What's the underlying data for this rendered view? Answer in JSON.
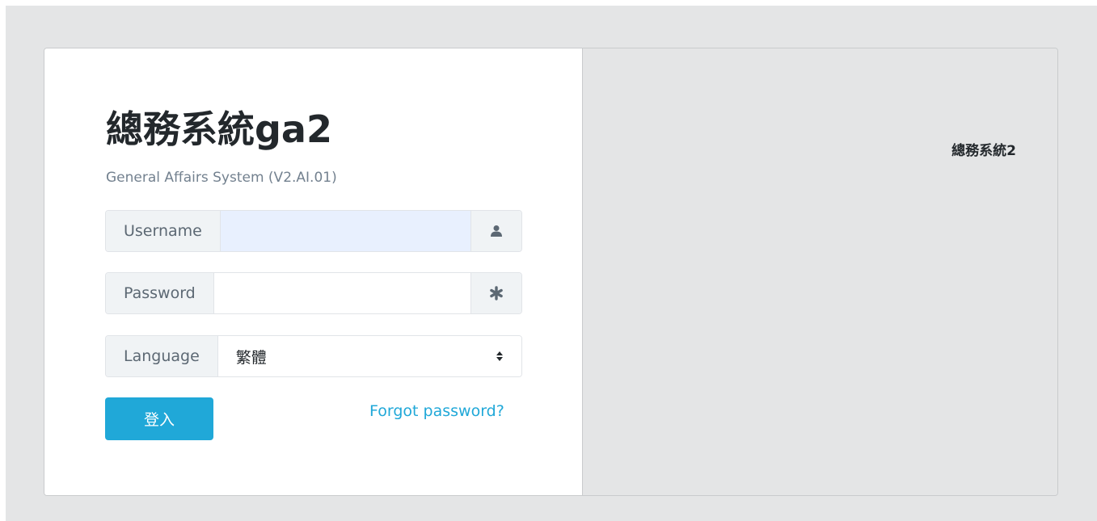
{
  "login": {
    "title": "總務系統ga2",
    "subtitle": "General Affairs System (V2.AI.01)",
    "username": {
      "label": "Username",
      "value": "",
      "icon": "user-icon"
    },
    "password": {
      "label": "Password",
      "value": "",
      "icon": "asterisk-icon"
    },
    "language": {
      "label": "Language",
      "selected": "繁體",
      "icon": "sort-arrows-icon"
    },
    "submit_label": "登入",
    "forgot_label": "Forgot password?"
  },
  "side": {
    "title": "總務系統2"
  },
  "colors": {
    "accent": "#20a8d8",
    "page_background": "#e4e5e6",
    "autofill_background": "#e8f0fe"
  }
}
